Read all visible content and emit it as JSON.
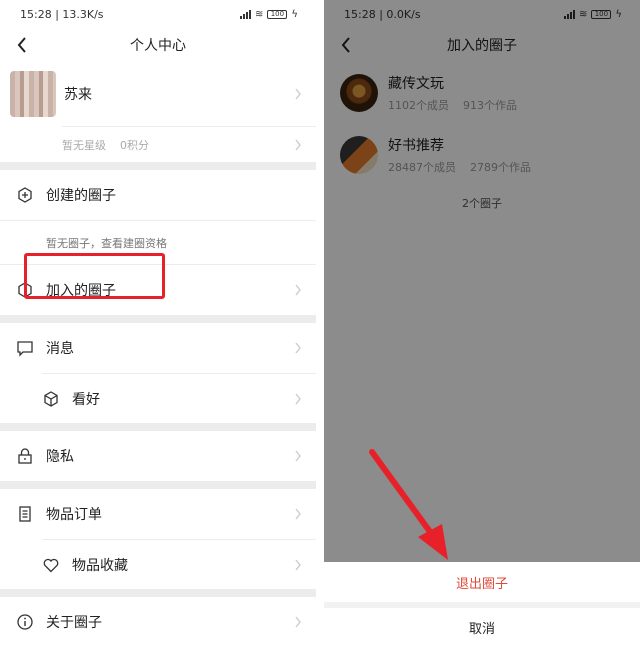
{
  "left": {
    "status": {
      "time_speed": "15:28 | 13.3K/s",
      "battery": "100"
    },
    "nav": {
      "title": "个人中心"
    },
    "profile": {
      "name": "苏来",
      "level": "暂无星级",
      "points": "0积分"
    },
    "created": {
      "label": "创建的圈子",
      "empty_hint": "暂无圈子，查看建圈资格"
    },
    "menu": [
      {
        "label": "加入的圈子",
        "icon": "hexagon-icon"
      },
      {
        "label": "消息",
        "icon": "message-icon"
      },
      {
        "label": "看好",
        "icon": "cube-icon"
      },
      {
        "label": "隐私",
        "icon": "lock-icon"
      },
      {
        "label": "物品订单",
        "icon": "document-icon"
      },
      {
        "label": "物品收藏",
        "icon": "heart-icon"
      },
      {
        "label": "关于圈子",
        "icon": "info-icon"
      }
    ]
  },
  "right": {
    "status": {
      "time_speed": "15:28 | 0.0K/s",
      "battery": "100"
    },
    "nav": {
      "title": "加入的圈子"
    },
    "circles": [
      {
        "name": "藏传文玩",
        "members": "1102个成员",
        "works": "913个作品"
      },
      {
        "name": "好书推荐",
        "members": "28487个成员",
        "works": "2789个作品"
      }
    ],
    "count": "2个圈子",
    "sheet": {
      "quit": "退出圈子",
      "cancel": "取消"
    }
  },
  "colors": {
    "highlight": "#e8202a",
    "quit_text": "#e04a3a",
    "dim": "rgba(0,0,0,0.45)"
  }
}
